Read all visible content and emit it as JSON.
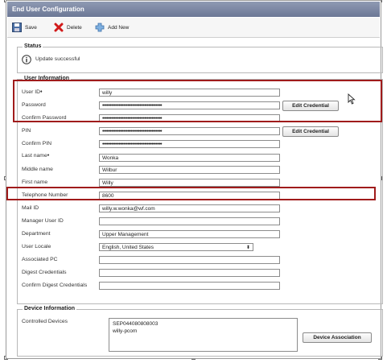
{
  "window": {
    "title": "End User Configuration"
  },
  "toolbar": {
    "save_label": "Save",
    "delete_label": "Delete",
    "add_new_label": "Add New"
  },
  "status": {
    "legend": "Status",
    "message": "Update successful"
  },
  "user_info": {
    "legend": "User Information",
    "fields": {
      "user_id": {
        "label": "User ID",
        "value": "willy"
      },
      "password": {
        "label": "Password",
        "value": "••••••••••••••••••••••••••••••••••••••••"
      },
      "confirm_password": {
        "label": "Confirm Password",
        "value": "••••••••••••••••••••••••••••••••••••••••"
      },
      "pin": {
        "label": "PIN",
        "value": "••••••••••••••••••••••••••••••••••••••••"
      },
      "confirm_pin": {
        "label": "Confirm PIN",
        "value": "••••••••••••••••••••••••••••••••••••••••"
      },
      "last_name": {
        "label": "Last name",
        "value": "Wonka"
      },
      "middle_name": {
        "label": "Middle name",
        "value": "Wilbur"
      },
      "first_name": {
        "label": "First name",
        "value": "Willy"
      },
      "telephone": {
        "label": "Telephone Number",
        "value": "8600"
      },
      "mail_id": {
        "label": "Mail ID",
        "value": "willy.w.wonka@wf.com"
      },
      "manager_user_id": {
        "label": "Manager User ID",
        "value": ""
      },
      "department": {
        "label": "Department",
        "value": "Upper Management"
      },
      "user_locale": {
        "label": "User Locale",
        "value": "English, United States"
      },
      "associated_pc": {
        "label": "Associated PC",
        "value": ""
      },
      "digest_credentials": {
        "label": "Digest Credentials",
        "value": ""
      },
      "confirm_digest_credentials": {
        "label": "Confirm Digest Credentials",
        "value": ""
      }
    },
    "edit_credential_label": "Edit Credential"
  },
  "device_info": {
    "legend": "Device Information",
    "controlled_devices_label": "Controlled Devices",
    "devices": [
      "SEP044080808003",
      "willy-pcom"
    ],
    "device_association_label": "Device Association"
  },
  "colors": {
    "highlight": "#a01b1b",
    "titlebar": "#7a86a3"
  }
}
